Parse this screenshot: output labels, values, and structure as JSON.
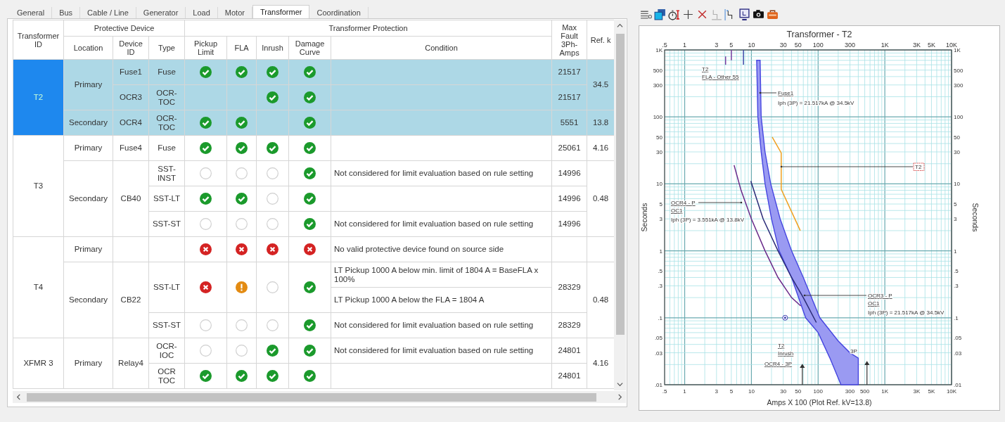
{
  "tabs": [
    {
      "label": "General",
      "selected": false
    },
    {
      "label": "Bus",
      "selected": false
    },
    {
      "label": "Cable / Line",
      "selected": false
    },
    {
      "label": "Generator",
      "selected": false
    },
    {
      "label": "Load",
      "selected": false
    },
    {
      "label": "Motor",
      "selected": false
    },
    {
      "label": "Transformer",
      "selected": true
    },
    {
      "label": "Coordination",
      "selected": false
    }
  ],
  "table": {
    "id_column": "Transformer ID",
    "header_groups": [
      {
        "label": "Protective Device",
        "columns": [
          "Location",
          "Device ID",
          "Type"
        ]
      },
      {
        "label": "Transformer Protection",
        "columns": [
          "Pickup Limit",
          "FLA",
          "Inrush",
          "Damage Curve",
          "Condition"
        ]
      }
    ],
    "fault_column": "Max Fault 3Ph-Amps",
    "kv_column": "Ref. k",
    "transformers": [
      {
        "id": "T2",
        "selected": true,
        "locations": [
          {
            "location": "Primary",
            "ref_kv": "34.5",
            "devices": [
              {
                "device_id": "Fuse1",
                "rows": [
                  {
                    "type": "Fuse",
                    "checks": [
                      {
                        "kind": "pass"
                      },
                      {
                        "kind": "pass"
                      },
                      {
                        "kind": "pass"
                      },
                      {
                        "kind": "pass"
                      }
                    ],
                    "max_fault": "21517"
                  }
                ]
              },
              {
                "device_id": "OCR3",
                "rows": [
                  {
                    "type": "OCR-TOC",
                    "checks": [
                      {
                        "kind": "none"
                      },
                      {
                        "kind": "none"
                      },
                      {
                        "kind": "pass"
                      },
                      {
                        "kind": "pass"
                      }
                    ],
                    "max_fault": "21517"
                  }
                ]
              }
            ]
          },
          {
            "location": "Secondary",
            "ref_kv": "13.8",
            "devices": [
              {
                "device_id": "OCR4",
                "rows": [
                  {
                    "type": "OCR-TOC",
                    "checks": [
                      {
                        "kind": "pass"
                      },
                      {
                        "kind": "pass"
                      },
                      {
                        "kind": "none"
                      },
                      {
                        "kind": "pass"
                      }
                    ],
                    "max_fault": "5551"
                  }
                ]
              }
            ]
          }
        ]
      },
      {
        "id": "T3",
        "selected": false,
        "locations": [
          {
            "location": "Primary",
            "ref_kv": "4.16",
            "devices": [
              {
                "device_id": "Fuse4",
                "rows": [
                  {
                    "type": "Fuse",
                    "checks": [
                      {
                        "kind": "pass"
                      },
                      {
                        "kind": "pass"
                      },
                      {
                        "kind": "pass"
                      },
                      {
                        "kind": "pass"
                      }
                    ],
                    "max_fault": "25061"
                  }
                ]
              }
            ]
          },
          {
            "location": "Secondary",
            "ref_kv": "0.48",
            "devices": [
              {
                "device_id": "CB40",
                "rows": [
                  {
                    "type": "SST-INST",
                    "checks": [
                      {
                        "kind": "na"
                      },
                      {
                        "kind": "na"
                      },
                      {
                        "kind": "na"
                      },
                      {
                        "kind": "pass"
                      }
                    ],
                    "conditions": [
                      "Not considered for limit evaluation based on rule setting"
                    ],
                    "max_fault": "14996"
                  },
                  {
                    "type": "SST-LT",
                    "checks": [
                      {
                        "kind": "pass"
                      },
                      {
                        "kind": "pass"
                      },
                      {
                        "kind": "na"
                      },
                      {
                        "kind": "pass"
                      }
                    ],
                    "max_fault": "14996"
                  },
                  {
                    "type": "SST-ST",
                    "checks": [
                      {
                        "kind": "na"
                      },
                      {
                        "kind": "na"
                      },
                      {
                        "kind": "na"
                      },
                      {
                        "kind": "pass"
                      }
                    ],
                    "conditions": [
                      "Not considered for limit evaluation based on rule setting"
                    ],
                    "max_fault": "14996"
                  }
                ]
              }
            ]
          }
        ]
      },
      {
        "id": "T4",
        "selected": false,
        "locations": [
          {
            "location": "Primary",
            "devices": [
              {
                "rows": [
                  {
                    "checks": [
                      {
                        "kind": "fail"
                      },
                      {
                        "kind": "fail"
                      },
                      {
                        "kind": "fail"
                      },
                      {
                        "kind": "fail"
                      }
                    ],
                    "conditions": [
                      "No valid protective device found on source side"
                    ]
                  }
                ]
              }
            ]
          },
          {
            "location": "Secondary",
            "ref_kv": "0.48",
            "devices": [
              {
                "device_id": "CB22",
                "rows": [
                  {
                    "type": "SST-LT",
                    "checks": [
                      {
                        "kind": "fail"
                      },
                      {
                        "kind": "warn"
                      },
                      {
                        "kind": "na"
                      },
                      {
                        "kind": "pass"
                      }
                    ],
                    "conditions": [
                      "LT Pickup 1000 A below min. limit of 1804 A = BaseFLA x 100%",
                      "LT Pickup 1000 A below the FLA = 1804 A"
                    ],
                    "max_fault": "28329"
                  },
                  {
                    "type": "SST-ST",
                    "checks": [
                      {
                        "kind": "na"
                      },
                      {
                        "kind": "na"
                      },
                      {
                        "kind": "na"
                      },
                      {
                        "kind": "pass"
                      }
                    ],
                    "conditions": [
                      "Not considered for limit evaluation based on rule setting"
                    ],
                    "max_fault": "28329"
                  }
                ]
              }
            ]
          }
        ]
      },
      {
        "id": "XFMR 3",
        "selected": false,
        "locations": [
          {
            "location": "Primary",
            "ref_kv": "4.16",
            "devices": [
              {
                "device_id": "Relay4",
                "rows": [
                  {
                    "type": "OCR-IOC",
                    "checks": [
                      {
                        "kind": "na"
                      },
                      {
                        "kind": "na"
                      },
                      {
                        "kind": "pass"
                      },
                      {
                        "kind": "pass"
                      }
                    ],
                    "conditions": [
                      "Not considered for limit evaluation based on rule setting"
                    ],
                    "max_fault": "24801"
                  },
                  {
                    "type": "OCR TOC",
                    "checks": [
                      {
                        "kind": "pass"
                      },
                      {
                        "kind": "pass"
                      },
                      {
                        "kind": "pass"
                      },
                      {
                        "kind": "pass"
                      }
                    ],
                    "max_fault": "24801"
                  }
                ]
              }
            ]
          }
        ]
      }
    ]
  },
  "plot": {
    "title": "Transformer - T2",
    "x_axis_title": "Amps X 100 (Plot Ref. kV=13.8)",
    "y_axis_title": "Seconds",
    "right_axis_title": "Seconds",
    "top_axis_labels": [
      ".5",
      "1",
      "3",
      "5",
      "10",
      "30",
      "50",
      "100",
      "300",
      "1K",
      "3K",
      "5K",
      "10K"
    ],
    "bottom_axis_labels": [
      ".5",
      "1",
      "3",
      "5",
      "10",
      "30",
      "50",
      "100",
      "300",
      "500",
      "1K",
      "3K",
      "5K",
      "10K"
    ],
    "left_axis_labels": [
      "1K",
      "500",
      "300",
      "100",
      "50",
      "30",
      "10",
      "5",
      "3",
      "1",
      ".5",
      ".3",
      ".1",
      ".05",
      ".03",
      ".01"
    ],
    "right_axis_labels": [
      "1K",
      "500",
      "300",
      "100",
      "50",
      "30",
      "10",
      "5",
      "3",
      "1",
      ".5",
      ".3",
      ".1",
      ".05",
      ".03",
      ".01"
    ],
    "notes": [
      "T2",
      "FLA - Other 55",
      "Fuse1",
      "Iph (3P) = 21.517kA @ 34.5kV",
      "T2",
      "OCR4 - P",
      "OC1",
      "Iph (3P) = 3.551kA @ 13.8kV",
      "OCR3 - P",
      "OC1",
      "Iph (3P) = 21.517kA @ 34.5kV",
      "3P",
      "T2",
      "Inrush",
      "OCR4 - 3P"
    ]
  }
}
